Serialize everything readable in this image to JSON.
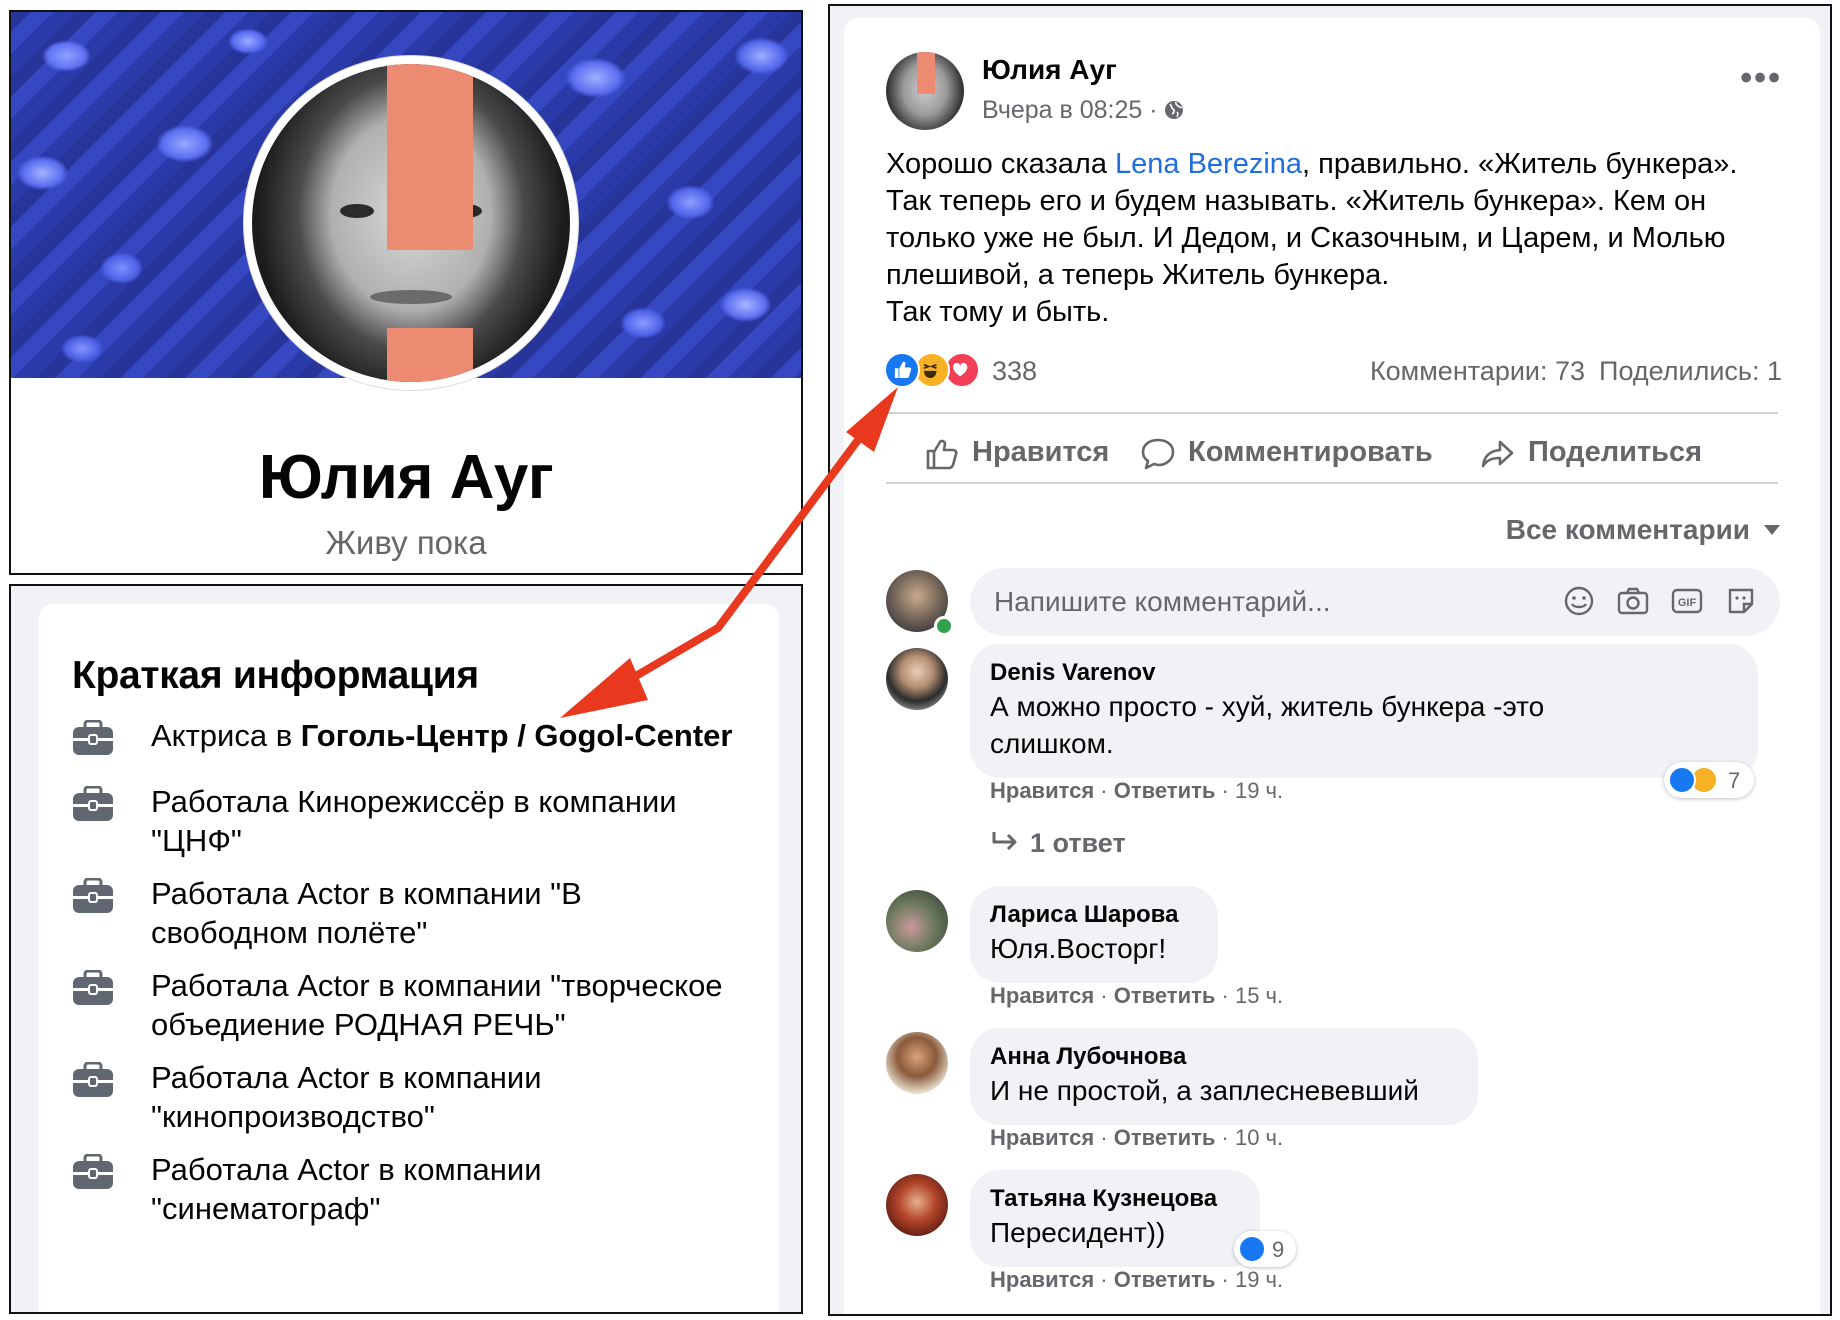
{
  "profile": {
    "name": "Юлия Ауг",
    "status": "Живу пока"
  },
  "intro": {
    "title": "Краткая информация",
    "items": [
      {
        "prefix": "Актриса в ",
        "bold": "Гоголь-Центр / Gogol-Center",
        "line2": ""
      },
      {
        "prefix": "Работала Кинорежиссёр в компании",
        "bold": "",
        "line2": "\"ЦНФ\""
      },
      {
        "prefix": "Работала Actor в компании \"В",
        "bold": "",
        "line2": "свободном полёте\""
      },
      {
        "prefix": "Работала Actor в компании \"творческое",
        "bold": "",
        "line2": "объедиение РОДНАЯ РЕЧЬ\""
      },
      {
        "prefix": "Работала Actor в компании",
        "bold": "",
        "line2": "\"кинопроизводство\""
      },
      {
        "prefix": "Работала Actor в компании",
        "bold": "",
        "line2": "\"синематограф\""
      }
    ]
  },
  "post": {
    "author": "Юлия Ауг",
    "time": "Вчера в 08:25 ·",
    "text_before_link": "Хорошо сказала ",
    "link": "Lena Berezina",
    "text_after_link": ", правильно. «Житель бункера».",
    "text_lines": [
      "Так теперь его и будем называть. «Житель бункера». Кем он",
      "только уже не был. И Дедом, и Сказочным, и Царем, и Молью",
      "плешивой, а теперь Житель бункера.",
      "Так тому и быть."
    ],
    "reaction_count": "338",
    "comments_count": "Комментарии: 73",
    "shares_count": "Поделились: 1",
    "actions": {
      "like": "Нравится",
      "comment": "Комментировать",
      "share": "Поделиться"
    },
    "all_comments": "Все комментарии",
    "comment_placeholder": "Напишите комментарий...",
    "input_icons": [
      "emoji-icon",
      "camera-icon",
      "gif-icon",
      "sticker-icon"
    ]
  },
  "comments": [
    {
      "name": "Denis Varenov",
      "lines": [
        "А можно просто - хуй, житель бункера -это",
        "слишком."
      ],
      "like": "Нравится",
      "reply": "Ответить",
      "time": "19 ч.",
      "reactions": "7",
      "replies": "1 ответ"
    },
    {
      "name": "Лариса Шарова",
      "lines": [
        "Юля.Восторг!"
      ],
      "like": "Нравится",
      "reply": "Ответить",
      "time": "15 ч."
    },
    {
      "name": "Анна Лубочнова",
      "lines": [
        "И не простой, а заплесневевший"
      ],
      "like": "Нравится",
      "reply": "Ответить",
      "time": "10 ч."
    },
    {
      "name": "Татьяна Кузнецова",
      "lines": [
        "Пересидент))"
      ],
      "like": "Нравится",
      "reply": "Ответить",
      "time": "19 ч.",
      "reactions": "9"
    }
  ],
  "colors": {
    "accent": "#1877f2",
    "link": "#216fdb",
    "secondary_text": "#65676b",
    "bubble": "#f0f2f5",
    "annotation_arrow": "#e8391f",
    "avatar_bar": "#ec8a72"
  }
}
